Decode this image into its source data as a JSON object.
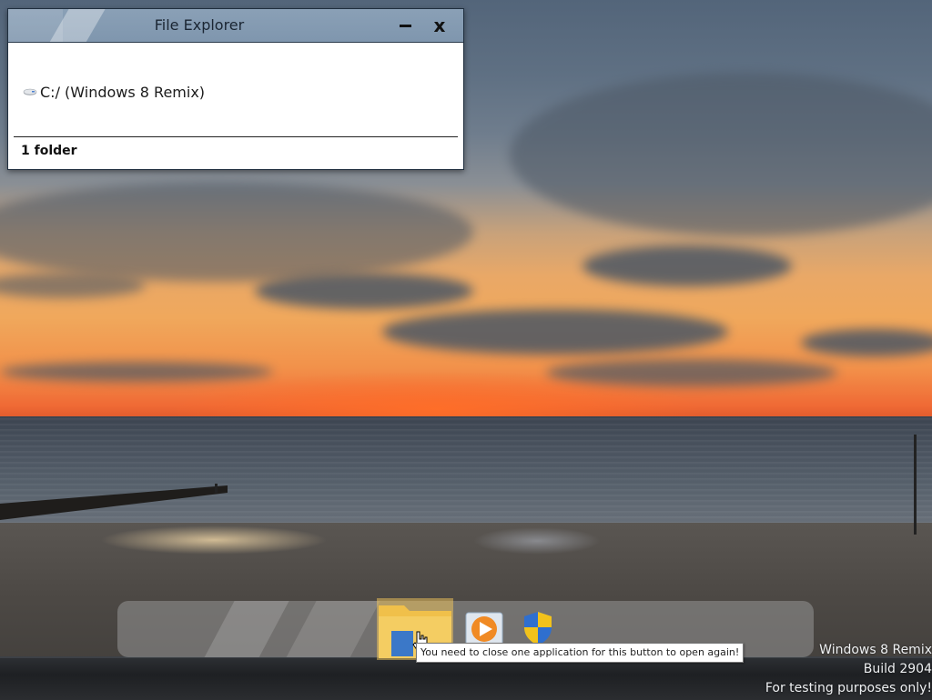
{
  "window": {
    "title": "File Explorer",
    "minimize_label": "",
    "close_label": "x",
    "items": [
      {
        "label": "C:/ (Windows 8 Remix)",
        "icon": "drive-icon"
      }
    ],
    "status": "1 folder"
  },
  "taskbar": {
    "buttons": [
      {
        "name": "file-explorer",
        "icon": "folder-icon"
      },
      {
        "name": "media-player",
        "icon": "media-player-icon"
      },
      {
        "name": "security",
        "icon": "shield-icon"
      }
    ],
    "tooltip": "You need to close one application for this button to open again!"
  },
  "watermark": {
    "line1": "Windows 8 Remix",
    "line2": "Build 2904",
    "line3": "For testing purposes only!"
  },
  "colors": {
    "titlebar": "#7f96ae",
    "folder": "#f0c04a",
    "shield_blue": "#2f6fcf",
    "shield_yellow": "#f2c21b"
  }
}
